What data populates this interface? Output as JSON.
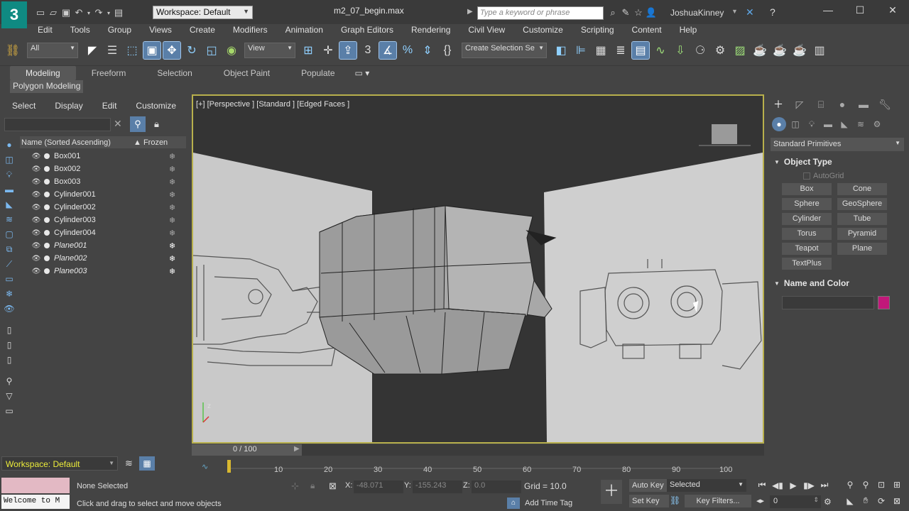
{
  "window": {
    "logo": "3",
    "doc_title": "m2_07_begin.max",
    "workspace": "Workspace: Default",
    "search_placeholder": "Type a keyword or phrase",
    "user": "JoshuaKinney"
  },
  "menu": [
    "Edit",
    "Tools",
    "Group",
    "Views",
    "Create",
    "Modifiers",
    "Animation",
    "Graph Editors",
    "Rendering",
    "Civil View",
    "Customize",
    "Scripting",
    "Content",
    "Help"
  ],
  "toolbar": {
    "filter": "All",
    "ref_coord": "View",
    "selection_set": "Create Selection Se",
    "snap_label": "3"
  },
  "ribbon": {
    "tabs": [
      "Modeling",
      "Freeform",
      "Selection",
      "Object Paint",
      "Populate"
    ],
    "active_tab": "Modeling",
    "subpanel": "Polygon Modeling"
  },
  "scene_explorer": {
    "menu": [
      "Select",
      "Display",
      "Edit",
      "Customize"
    ],
    "column_name": "Name (Sorted Ascending)",
    "column_frozen": "▲ Frozen",
    "items": [
      {
        "name": "Box001"
      },
      {
        "name": "Box002"
      },
      {
        "name": "Box003"
      },
      {
        "name": "Cylinder001"
      },
      {
        "name": "Cylinder002"
      },
      {
        "name": "Cylinder003"
      },
      {
        "name": "Cylinder004"
      },
      {
        "name": "Plane001"
      },
      {
        "name": "Plane002"
      },
      {
        "name": "Plane003"
      }
    ]
  },
  "viewport": {
    "label": "[+] [Perspective ] [Standard ] [Edged Faces ]"
  },
  "command_panel": {
    "category": "Standard Primitives",
    "object_type_title": "Object Type",
    "autogrid": "AutoGrid",
    "primitives": [
      "Box",
      "Cone",
      "Sphere",
      "GeoSphere",
      "Cylinder",
      "Tube",
      "Torus",
      "Pyramid",
      "Teapot",
      "Plane",
      "TextPlus"
    ],
    "name_color_title": "Name and Color",
    "swatch_color": "#c2187a"
  },
  "timeline": {
    "frame": "0 / 100",
    "ticks": [
      "10",
      "20",
      "30",
      "40",
      "50",
      "60",
      "70",
      "80",
      "90",
      "100"
    ]
  },
  "status": {
    "workspace": "Workspace: Default",
    "welcome": "Welcome to M",
    "selection": "None Selected",
    "prompt": "Click and drag to select and move objects",
    "x_label": "X:",
    "x_val": "-48.071",
    "y_label": "Y:",
    "y_val": "-155.243",
    "z_label": "Z:",
    "z_val": "0.0",
    "grid": "Grid = 10.0",
    "add_time_tag": "Add Time Tag",
    "auto_key": "Auto Key",
    "set_key": "Set Key",
    "selected": "Selected",
    "key_filters": "Key Filters...",
    "frame_field": "0"
  }
}
